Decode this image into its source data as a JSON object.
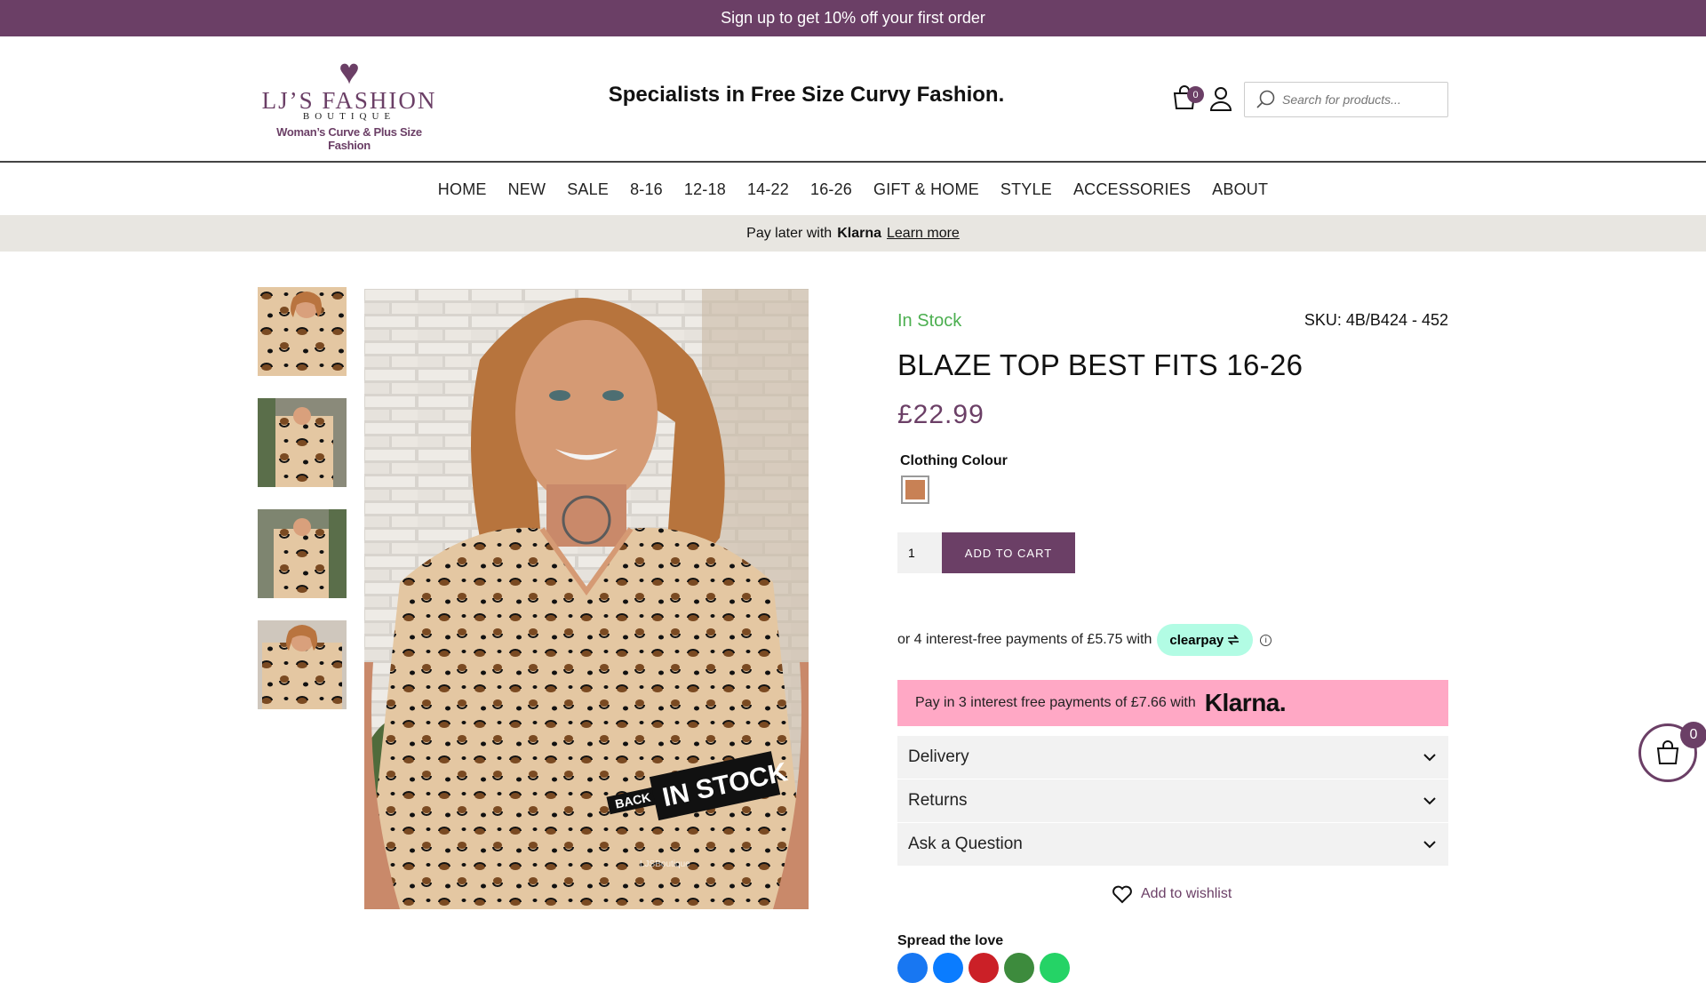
{
  "promo": {
    "text": "Sign up to get 10% off your first order"
  },
  "header": {
    "logo": {
      "name": "LJ’S FASHION",
      "sub": "BOUTIQUE",
      "tagline": "Woman’s Curve & Plus Size Fashion"
    },
    "tagline": "Specialists in Free Size Curvy Fashion.",
    "cart_count": "0",
    "search_placeholder": "Search for products..."
  },
  "nav": [
    "HOME",
    "NEW",
    "SALE",
    "8-16",
    "12-18",
    "14-22",
    "16-26",
    "GIFT & HOME",
    "STYLE",
    "ACCESSORIES",
    "ABOUT"
  ],
  "klarna_bar": {
    "prefix": "Pay later with",
    "brand": "Klarna",
    "link": "Learn more"
  },
  "product": {
    "stock": "In Stock",
    "sku": "SKU: 4B/B424 - 452",
    "title": "BLAZE TOP BEST FITS 16-26",
    "price": "£22.99",
    "colour_label": "Clothing Colour",
    "swatch_color": "#c88155",
    "qty": "1",
    "add_to_cart": "ADD TO CART",
    "clearpay_text": "or 4 interest-free payments of £5.75 with",
    "clearpay_brand": "clearpay",
    "klarna_text": "Pay in 3 interest free payments of £7.66 with",
    "klarna_brand": "Klarna.",
    "accordion": [
      "Delivery",
      "Returns",
      "Ask a Question"
    ],
    "wishlist": "Add to wishlist",
    "spread": "Spread the love",
    "image_badge_small": "BACK",
    "image_badge_large": "IN STOCK",
    "image_watermark": "LJSBoutique"
  },
  "floating_cart_count": "0",
  "colors": {
    "brand": "#6b3f66",
    "stock": "#4caf50",
    "klarna_pink": "#ffa8c5",
    "clearpay_mint": "#b2fce4"
  }
}
